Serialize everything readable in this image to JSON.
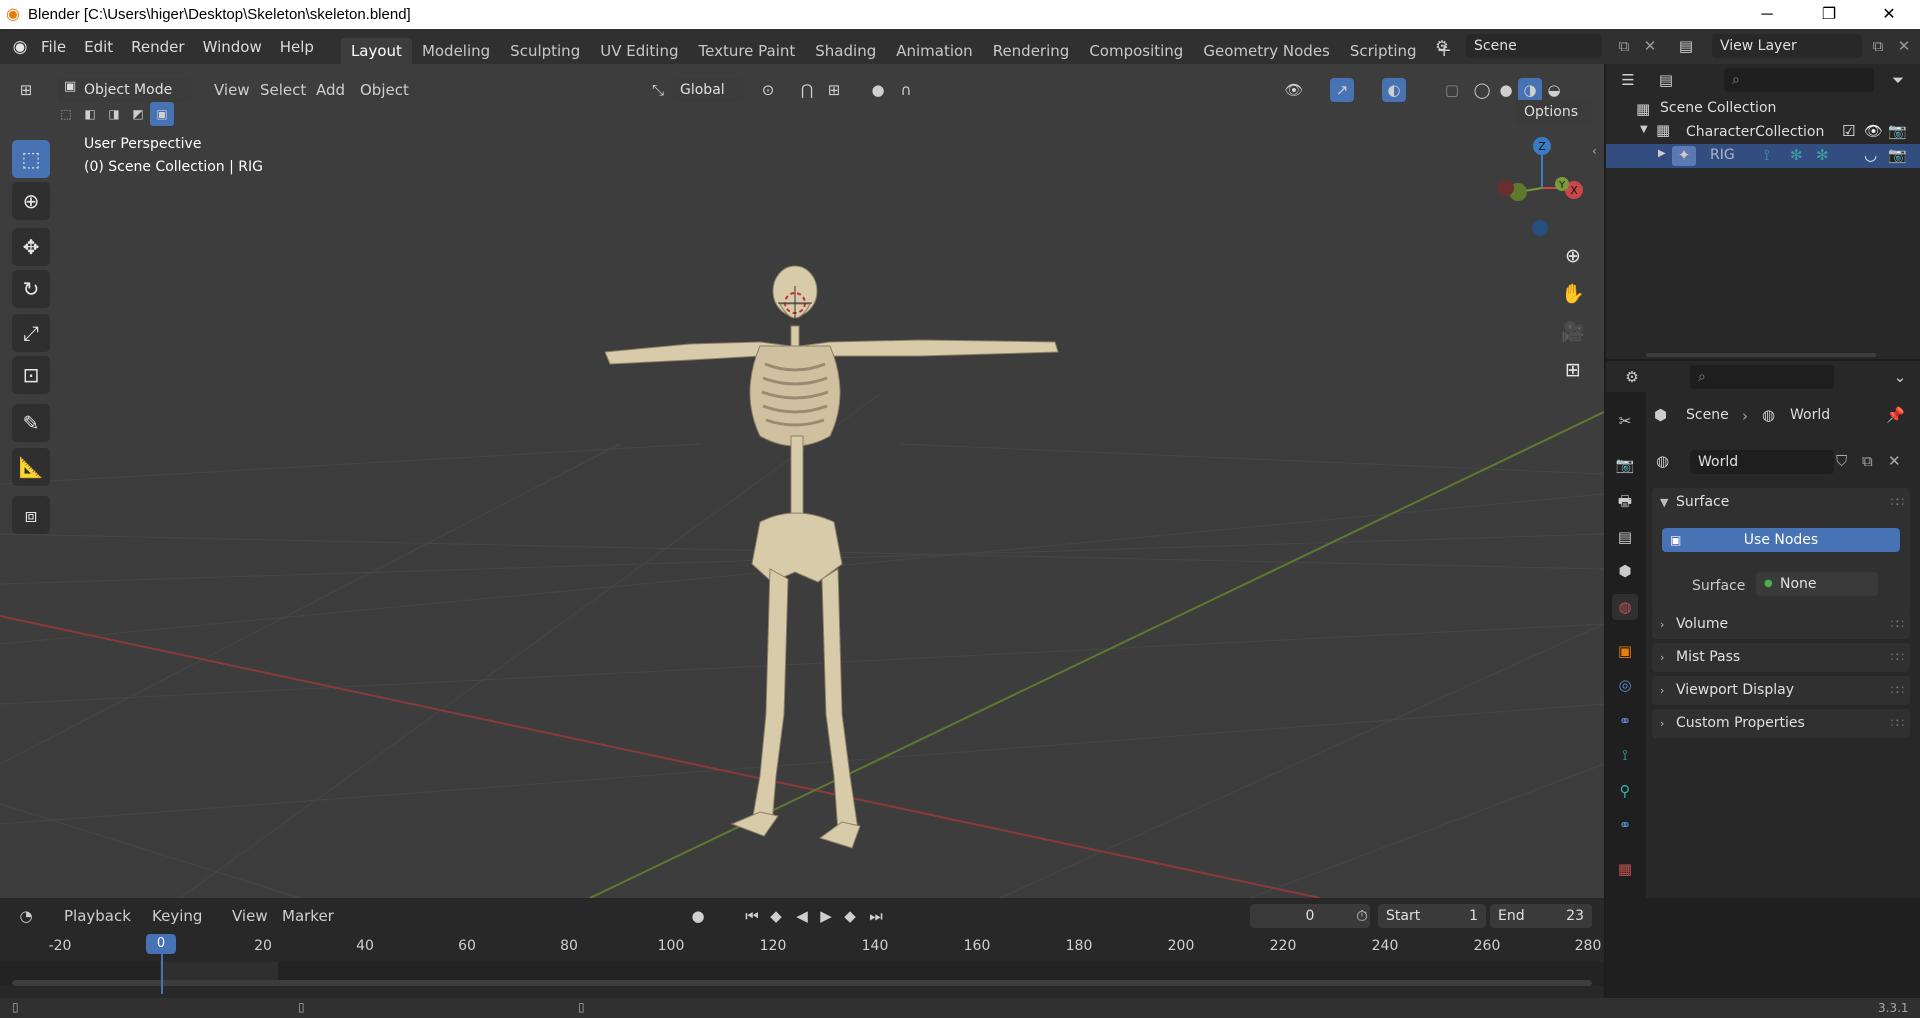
{
  "window": {
    "title": "Blender [C:\\Users\\higer\\Desktop\\Skeleton\\skeleton.blend]"
  },
  "menu": [
    "File",
    "Edit",
    "Render",
    "Window",
    "Help"
  ],
  "workspaces": [
    "Layout",
    "Modeling",
    "Sculpting",
    "UV Editing",
    "Texture Paint",
    "Shading",
    "Animation",
    "Rendering",
    "Compositing",
    "Geometry Nodes",
    "Scripting"
  ],
  "active_workspace": "Layout",
  "scene_name": "Scene",
  "view_layer": "View Layer",
  "viewport": {
    "mode": "Object Mode",
    "menus": [
      "View",
      "Select",
      "Add",
      "Object"
    ],
    "transform_orientation": "Global",
    "options_label": "Options",
    "overlay_title": "User Perspective",
    "overlay_subtitle": "(0) Scene Collection | RIG",
    "gizmo": {
      "z": "Z",
      "y": "Y",
      "x": "X"
    }
  },
  "outliner": {
    "root": "Scene Collection",
    "collection": "CharacterCollection",
    "object": "RIG"
  },
  "properties": {
    "breadcrumb": [
      "Scene",
      "World"
    ],
    "world_name": "World",
    "panels": {
      "surface": "Surface",
      "use_nodes": "Use Nodes",
      "surface_label": "Surface",
      "surface_value": "None",
      "volume": "Volume",
      "mist": "Mist Pass",
      "viewport_display": "Viewport Display",
      "custom_properties": "Custom Properties"
    }
  },
  "timeline": {
    "menus": [
      "Playback",
      "Keying",
      "View",
      "Marker"
    ],
    "current_frame": "0",
    "start_label": "Start",
    "start": "1",
    "end_label": "End",
    "end": "23",
    "ruler": [
      "-20",
      "0",
      "20",
      "40",
      "60",
      "80",
      "100",
      "120",
      "140",
      "160",
      "180",
      "200",
      "220",
      "240",
      "260",
      "280"
    ],
    "playhead": "0"
  },
  "status": {
    "version": "3.3.1"
  },
  "colors": {
    "accent": "#4772b3",
    "x_axis": "#c84848",
    "y_axis": "#7a9a3c",
    "z_axis": "#3a7cc4",
    "bone": "#d8cbaa"
  }
}
